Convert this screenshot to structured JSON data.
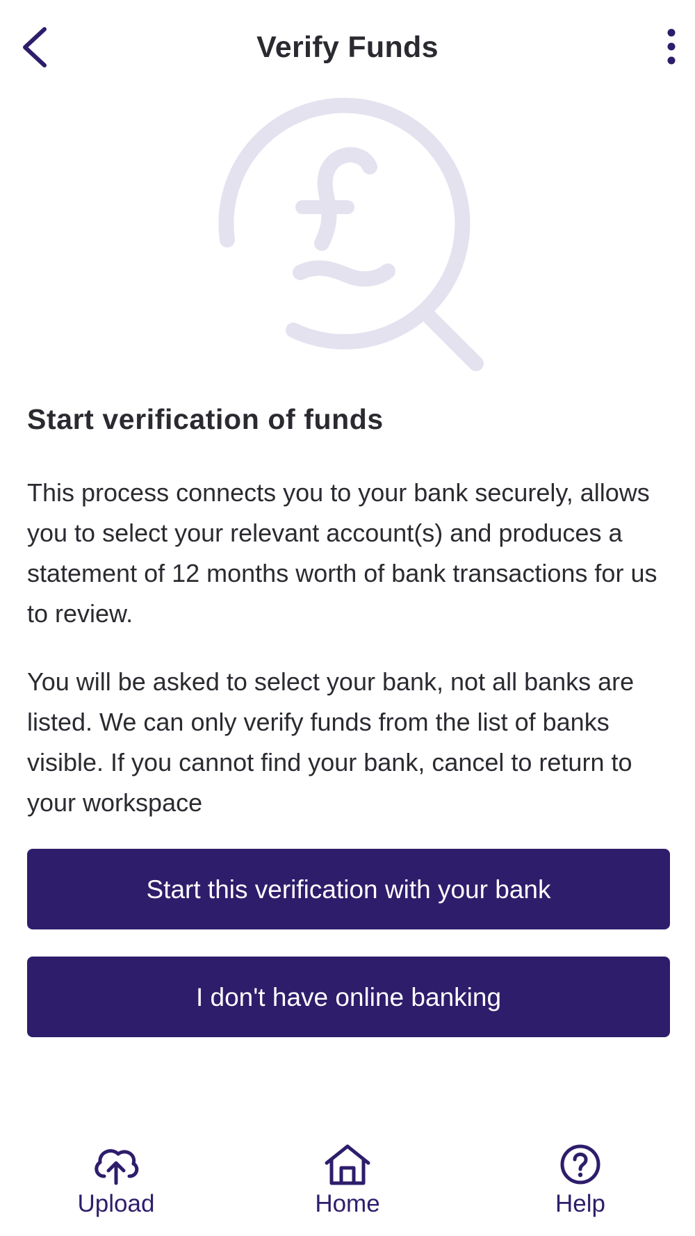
{
  "header": {
    "title": "Verify Funds",
    "back_icon": "chevron-left-icon",
    "more_icon": "more-vertical-icon"
  },
  "hero": {
    "icon": "pound-magnifier-icon"
  },
  "main": {
    "heading": "Start verification of funds",
    "paragraphs": [
      "This process connects you to your bank securely, allows you to select your relevant account(s) and produces a statement of 12 months worth of bank transactions for us to review.",
      "You will be asked to select your bank, not all banks are listed. We can only verify funds from the list of banks visible. If you cannot find your bank, cancel to return to your workspace"
    ],
    "buttons": {
      "start_label": "Start this verification with your bank",
      "no_banking_label": "I don't have online banking"
    }
  },
  "bottom_nav": {
    "items": [
      {
        "label": "Upload",
        "icon": "cloud-upload-icon"
      },
      {
        "label": "Home",
        "icon": "home-icon"
      },
      {
        "label": "Help",
        "icon": "help-circle-icon"
      }
    ]
  },
  "colors": {
    "brand": "#2e1d6b",
    "text": "#2a2a30",
    "hero_icon": "#e4e2ef",
    "background": "#ffffff"
  }
}
